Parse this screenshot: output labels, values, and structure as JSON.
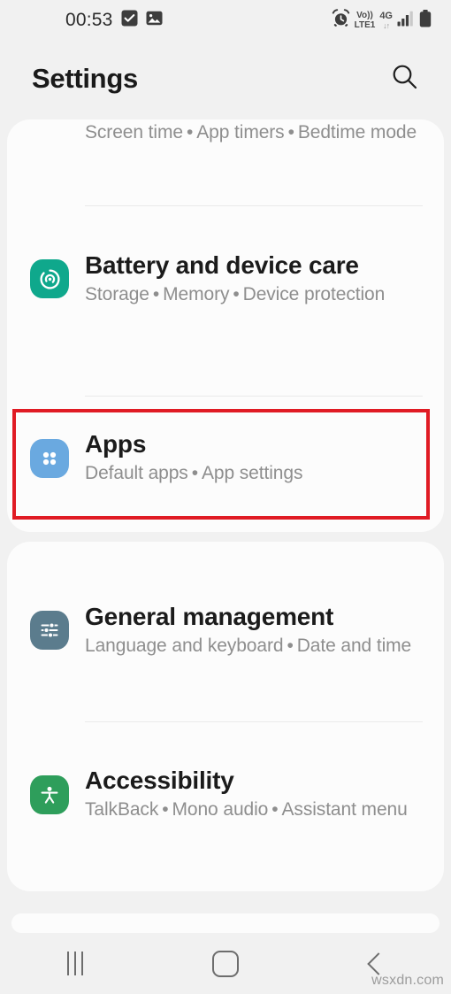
{
  "status_bar": {
    "time": "00:53",
    "left_icons": [
      "checkbox-checked-icon",
      "image-icon"
    ],
    "alarm_icon": "alarm-icon",
    "volte": {
      "top": "Vo))",
      "bottom": "LTE1"
    },
    "network": {
      "type": "4G",
      "data_arrows": "↓↑"
    },
    "signal_icon": "signal-bars-icon",
    "battery_icon": "battery-full-icon"
  },
  "header": {
    "title": "Settings",
    "search_icon": "search-icon"
  },
  "cards": [
    {
      "id": "card-one",
      "rows": [
        {
          "name": "digital-wellbeing",
          "title": "",
          "subtitle_parts": [
            "Screen time",
            "App timers",
            "Bedtime mode"
          ],
          "subtitle": "Screen time • App timers • Bedtime mode",
          "icon": "digital-wellbeing-icon",
          "icon_color": "#4a6572",
          "partially_scrolled": true
        },
        {
          "name": "battery-and-device-care",
          "title": "Battery and device care",
          "subtitle_parts": [
            "Storage",
            "Memory",
            "Device protection"
          ],
          "subtitle": "Storage • Memory • Device protection",
          "icon": "device-care-icon",
          "icon_color": "#0fa88c"
        },
        {
          "name": "apps",
          "title": "Apps",
          "subtitle_parts": [
            "Default apps",
            "App settings"
          ],
          "subtitle": "Default apps • App settings",
          "icon": "apps-grid-icon",
          "icon_color": "#6aa9e0",
          "highlighted": true
        }
      ]
    },
    {
      "id": "card-two",
      "rows": [
        {
          "name": "general-management",
          "title": "General management",
          "subtitle_parts": [
            "Language and keyboard",
            "Date and time"
          ],
          "subtitle": "Language and keyboard • Date and time",
          "icon": "sliders-icon",
          "icon_color": "#5b7c8d"
        },
        {
          "name": "accessibility",
          "title": "Accessibility",
          "subtitle_parts": [
            "TalkBack",
            "Mono audio",
            "Assistant menu"
          ],
          "subtitle": "TalkBack • Mono audio • Assistant menu",
          "icon": "accessibility-person-icon",
          "icon_color": "#2e9e5b"
        }
      ]
    }
  ],
  "annotation": {
    "type": "rectangle-highlight",
    "target": "apps",
    "color": "#e01b24"
  },
  "navigation_bar": {
    "recents_label": "recents-icon",
    "home_label": "home-icon",
    "back_label": "back-icon"
  },
  "watermark": {
    "text": "wsxdn.com"
  },
  "colors": {
    "page_background": "#f1f1f1",
    "card_background": "#fcfcfc",
    "title_text": "#1b1b1b",
    "subtitle_text": "#8e8e8e",
    "divider": "#eaeaea",
    "highlight": "#e01b24"
  }
}
